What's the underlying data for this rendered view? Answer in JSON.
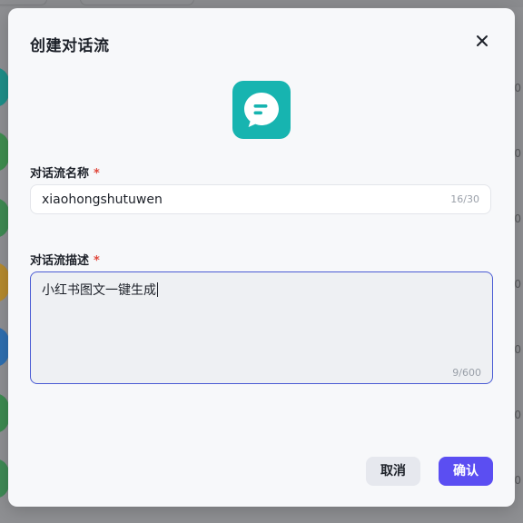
{
  "dialog": {
    "title": "创建对话流",
    "close_icon": "close-icon",
    "app_icon": "chat-bubble-icon",
    "accent_color": "#17b4b0"
  },
  "name_field": {
    "label": "对话流名称",
    "required_mark": "*",
    "value": "xiaohongshutuwen",
    "counter": "16/30"
  },
  "description_field": {
    "label": "对话流描述",
    "required_mark": "*",
    "value": "小红书图文一键生成",
    "counter": "9/600"
  },
  "buttons": {
    "cancel_label": "取消",
    "confirm_label": "确认",
    "confirm_color": "#5b4ef2"
  }
}
